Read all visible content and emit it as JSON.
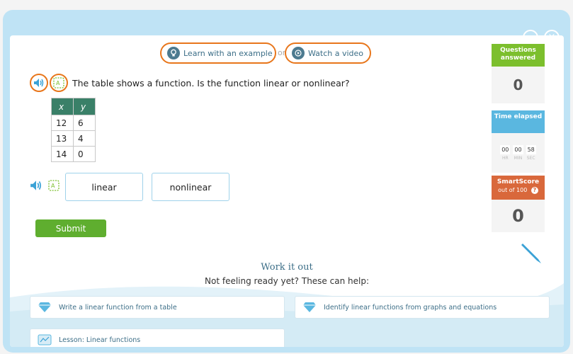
{
  "window": {
    "minimize_icon": "minus-circle-icon",
    "close_icon": "close-circle-icon"
  },
  "help": {
    "example_label": "Learn with an example",
    "or_label": "or",
    "video_label": "Watch a video"
  },
  "question": {
    "text": "The table shows a function. Is the function linear or nonlinear?",
    "table": {
      "headers": [
        "x",
        "y"
      ],
      "rows": [
        [
          "12",
          "6"
        ],
        [
          "13",
          "4"
        ],
        [
          "14",
          "0"
        ]
      ]
    }
  },
  "answers": {
    "choices": [
      "linear",
      "nonlinear"
    ]
  },
  "submit_label": "Submit",
  "sidebar": {
    "questions_label": "Questions answered",
    "questions_count": "0",
    "time_label": "Time elapsed",
    "timer": {
      "hr": "00",
      "min": "00",
      "sec": "58",
      "hr_label": "HR",
      "min_label": "MIN",
      "sec_label": "SEC"
    },
    "smartscore_label": "SmartScore",
    "smartscore_sub": "out of 100",
    "smartscore_help": "?",
    "smartscore_value": "0"
  },
  "work_it_out": {
    "title": "Work it out",
    "subtitle": "Not feeling ready yet? These can help:",
    "links": [
      "Write a linear function from a table",
      "Identify linear functions from graphs and equations",
      "Lesson: Linear functions"
    ]
  },
  "colors": {
    "accent_orange": "#e8761b",
    "submit_green": "#5fae2f",
    "table_header": "#3a8068",
    "frame_blue": "#bfe3f5"
  }
}
